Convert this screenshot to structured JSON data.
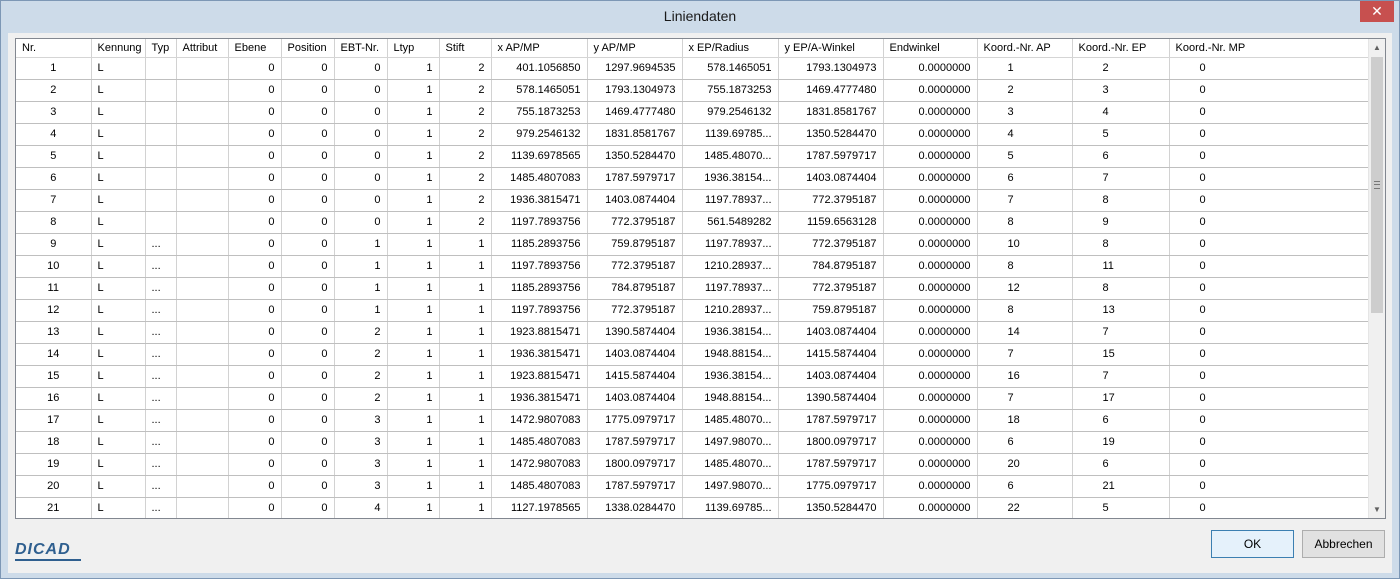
{
  "window": {
    "title": "Liniendaten",
    "close_label": "✕"
  },
  "columns": [
    "Nr.",
    "Kennung",
    "Typ",
    "Attribut",
    "Ebene",
    "Position",
    "EBT-Nr.",
    "Ltyp",
    "Stift",
    "x AP/MP",
    "y AP/MP",
    "x EP/Radius",
    "y EP/A-Winkel",
    "Endwinkel",
    "Koord.-Nr. AP",
    "Koord.-Nr. EP",
    "Koord.-Nr. MP"
  ],
  "rows": [
    [
      "1",
      "L",
      "",
      "",
      "0",
      "0",
      "0",
      "1",
      "2",
      "401.1056850",
      "1297.9694535",
      "578.1465051",
      "1793.1304973",
      "0.0000000",
      "1",
      "2",
      "0"
    ],
    [
      "2",
      "L",
      "",
      "",
      "0",
      "0",
      "0",
      "1",
      "2",
      "578.1465051",
      "1793.1304973",
      "755.1873253",
      "1469.4777480",
      "0.0000000",
      "2",
      "3",
      "0"
    ],
    [
      "3",
      "L",
      "",
      "",
      "0",
      "0",
      "0",
      "1",
      "2",
      "755.1873253",
      "1469.4777480",
      "979.2546132",
      "1831.8581767",
      "0.0000000",
      "3",
      "4",
      "0"
    ],
    [
      "4",
      "L",
      "",
      "",
      "0",
      "0",
      "0",
      "1",
      "2",
      "979.2546132",
      "1831.8581767",
      "1139.69785...",
      "1350.5284470",
      "0.0000000",
      "4",
      "5",
      "0"
    ],
    [
      "5",
      "L",
      "",
      "",
      "0",
      "0",
      "0",
      "1",
      "2",
      "1139.6978565",
      "1350.5284470",
      "1485.48070...",
      "1787.5979717",
      "0.0000000",
      "5",
      "6",
      "0"
    ],
    [
      "6",
      "L",
      "",
      "",
      "0",
      "0",
      "0",
      "1",
      "2",
      "1485.4807083",
      "1787.5979717",
      "1936.38154...",
      "1403.0874404",
      "0.0000000",
      "6",
      "7",
      "0"
    ],
    [
      "7",
      "L",
      "",
      "",
      "0",
      "0",
      "0",
      "1",
      "2",
      "1936.3815471",
      "1403.0874404",
      "1197.78937...",
      "772.3795187",
      "0.0000000",
      "7",
      "8",
      "0"
    ],
    [
      "8",
      "L",
      "",
      "",
      "0",
      "0",
      "0",
      "1",
      "2",
      "1197.7893756",
      "772.3795187",
      "561.5489282",
      "1159.6563128",
      "0.0000000",
      "8",
      "9",
      "0"
    ],
    [
      "9",
      "L",
      "...",
      "",
      "0",
      "0",
      "1",
      "1",
      "1",
      "1185.2893756",
      "759.8795187",
      "1197.78937...",
      "772.3795187",
      "0.0000000",
      "10",
      "8",
      "0"
    ],
    [
      "10",
      "L",
      "...",
      "",
      "0",
      "0",
      "1",
      "1",
      "1",
      "1197.7893756",
      "772.3795187",
      "1210.28937...",
      "784.8795187",
      "0.0000000",
      "8",
      "11",
      "0"
    ],
    [
      "11",
      "L",
      "...",
      "",
      "0",
      "0",
      "1",
      "1",
      "1",
      "1185.2893756",
      "784.8795187",
      "1197.78937...",
      "772.3795187",
      "0.0000000",
      "12",
      "8",
      "0"
    ],
    [
      "12",
      "L",
      "...",
      "",
      "0",
      "0",
      "1",
      "1",
      "1",
      "1197.7893756",
      "772.3795187",
      "1210.28937...",
      "759.8795187",
      "0.0000000",
      "8",
      "13",
      "0"
    ],
    [
      "13",
      "L",
      "...",
      "",
      "0",
      "0",
      "2",
      "1",
      "1",
      "1923.8815471",
      "1390.5874404",
      "1936.38154...",
      "1403.0874404",
      "0.0000000",
      "14",
      "7",
      "0"
    ],
    [
      "14",
      "L",
      "...",
      "",
      "0",
      "0",
      "2",
      "1",
      "1",
      "1936.3815471",
      "1403.0874404",
      "1948.88154...",
      "1415.5874404",
      "0.0000000",
      "7",
      "15",
      "0"
    ],
    [
      "15",
      "L",
      "...",
      "",
      "0",
      "0",
      "2",
      "1",
      "1",
      "1923.8815471",
      "1415.5874404",
      "1936.38154...",
      "1403.0874404",
      "0.0000000",
      "16",
      "7",
      "0"
    ],
    [
      "16",
      "L",
      "...",
      "",
      "0",
      "0",
      "2",
      "1",
      "1",
      "1936.3815471",
      "1403.0874404",
      "1948.88154...",
      "1390.5874404",
      "0.0000000",
      "7",
      "17",
      "0"
    ],
    [
      "17",
      "L",
      "...",
      "",
      "0",
      "0",
      "3",
      "1",
      "1",
      "1472.9807083",
      "1775.0979717",
      "1485.48070...",
      "1787.5979717",
      "0.0000000",
      "18",
      "6",
      "0"
    ],
    [
      "18",
      "L",
      "...",
      "",
      "0",
      "0",
      "3",
      "1",
      "1",
      "1485.4807083",
      "1787.5979717",
      "1497.98070...",
      "1800.0979717",
      "0.0000000",
      "6",
      "19",
      "0"
    ],
    [
      "19",
      "L",
      "...",
      "",
      "0",
      "0",
      "3",
      "1",
      "1",
      "1472.9807083",
      "1800.0979717",
      "1485.48070...",
      "1787.5979717",
      "0.0000000",
      "20",
      "6",
      "0"
    ],
    [
      "20",
      "L",
      "...",
      "",
      "0",
      "0",
      "3",
      "1",
      "1",
      "1485.4807083",
      "1787.5979717",
      "1497.98070...",
      "1775.0979717",
      "0.0000000",
      "6",
      "21",
      "0"
    ],
    [
      "21",
      "L",
      "...",
      "",
      "0",
      "0",
      "4",
      "1",
      "1",
      "1127.1978565",
      "1338.0284470",
      "1139.69785...",
      "1350.5284470",
      "0.0000000",
      "22",
      "5",
      "0"
    ]
  ],
  "footer": {
    "logo": "DICAD",
    "ok_label": "OK",
    "cancel_label": "Abbrechen"
  },
  "icons": {
    "scroll_up": "chevron-up-icon",
    "scroll_down": "chevron-down-icon"
  },
  "colors": {
    "window_border": "#7d97b5",
    "close_button": "#c7504f",
    "logo": "#2f5f8f"
  }
}
